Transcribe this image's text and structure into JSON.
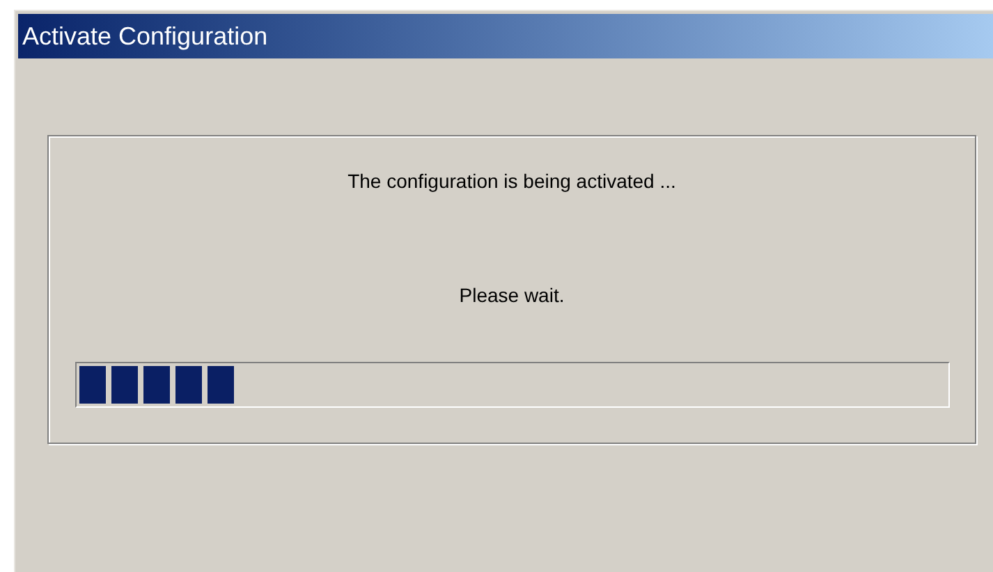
{
  "window": {
    "title": "Activate Configuration"
  },
  "message": "The configuration is being activated ...",
  "hint": "Please wait.",
  "progress": {
    "level": 0.18
  }
}
